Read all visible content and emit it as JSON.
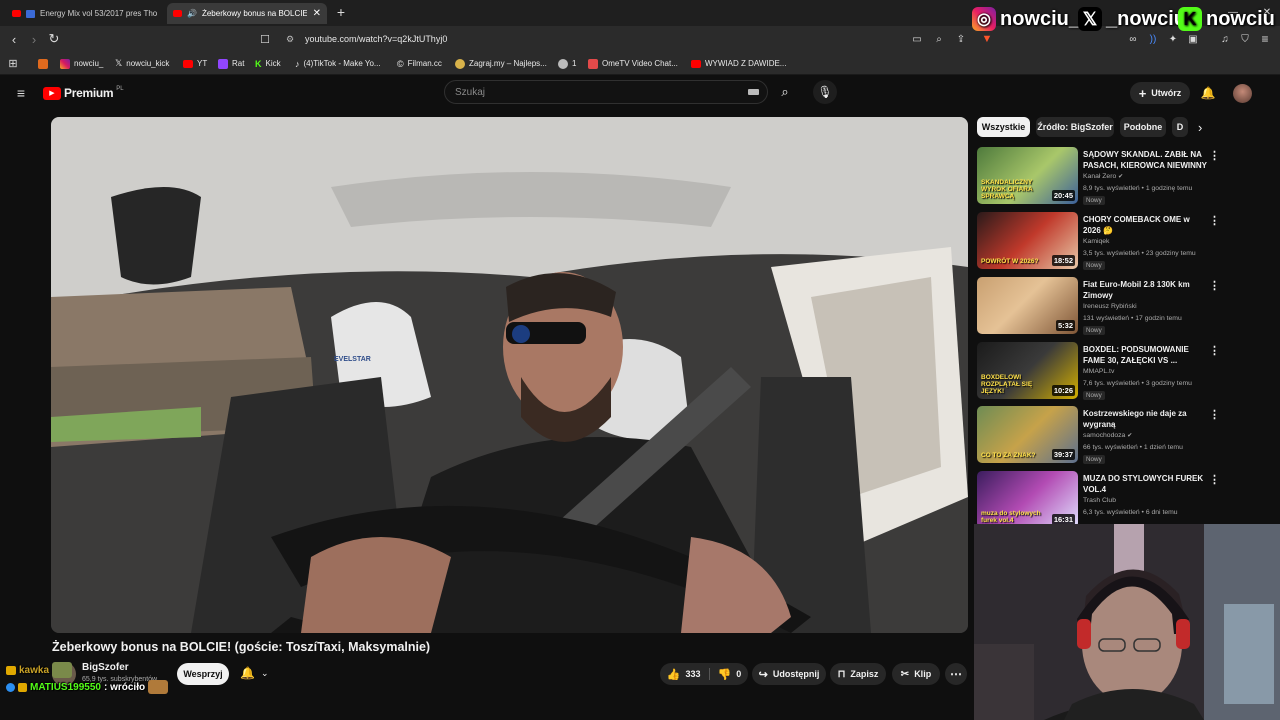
{
  "tabs": [
    {
      "title": "Energy Mix vol 53/2017 pres Tho"
    },
    {
      "title": "Żeberkowy bonus na BOLCIE!"
    }
  ],
  "address": {
    "url": "youtube.com/watch?v=q2kJtUThyj0"
  },
  "bookmarks": [
    "nowciu_",
    "nowciu_kick",
    "YT",
    "Rat",
    "Kick",
    "(4)TikTok - Make Yo...",
    "Filman.cc",
    "Zagraj.my – Najleps...",
    "1",
    "OmeTV Video Chat...",
    "WYWIAD Z DAWIDE..."
  ],
  "socials": {
    "instagram": "nowciu_",
    "x": "_nowciu",
    "kick": "nowciu"
  },
  "youtube": {
    "logo": "Premium",
    "logo_badge": "PL",
    "search_placeholder": "Szukaj",
    "create_label": "Utwórz"
  },
  "video": {
    "title": "Żeberkowy bonus na BOLCIE! (goście: ToszíTaxi, Maksymalnie)",
    "seat_brand": "EVELSTAR"
  },
  "channel": {
    "name": "BigSzofer",
    "subscribers": "65,9 tys. subskrybentów",
    "support_label": "Wesprzyj"
  },
  "actions": {
    "likes": "333",
    "dislikes": "0",
    "share": "Udostępnij",
    "save": "Zapisz",
    "clip": "Klip"
  },
  "chips": [
    "Wszystkie",
    "Źródło: BigSzofer",
    "Podobne",
    "D"
  ],
  "recommendations": [
    {
      "title": "SĄDOWY SKANDAL. ZABIŁ NA PASACH, KIEROWCA NIEWINNY",
      "channel": "Kanał Zero",
      "verified": true,
      "meta": "8,9 tys. wyświetleń • 1 godzinę temu",
      "badge": "Nowy",
      "duration": "20:45",
      "thumb_text": "SKANDALICZNY WYROK OFIARA SPRAWCĄ"
    },
    {
      "title": "CHORY COMEBACK OME w 2026 🤔",
      "channel": "Kamiqek",
      "verified": false,
      "meta": "3,5 tys. wyświetleń • 23 godziny temu",
      "badge": "Nowy",
      "duration": "18:52",
      "thumb_text": "POWRÓT W 2026?"
    },
    {
      "title": "Fiat Euro-Mobil 2.8 130K km Zimowy",
      "channel": "Ireneusz Rybiński",
      "verified": false,
      "meta": "131 wyświetleń • 17 godzin temu",
      "badge": "Nowy",
      "duration": "5:32",
      "thumb_text": ""
    },
    {
      "title": "BOXDEL: PODSUMOWANIE FAME 30, ZAŁĘCKI VS ...",
      "channel": "MMAPL.tv",
      "verified": false,
      "meta": "7,6 tys. wyświetleń • 3 godziny temu",
      "badge": "Nowy",
      "duration": "10:26",
      "thumb_text": "BOXDELOWI ROZPLĄTAŁ SIĘ JĘZYK!"
    },
    {
      "title": "Kostrzewskiego nie daje za wygraną",
      "channel": "samochodoza",
      "verified": true,
      "meta": "66 tys. wyświetleń • 1 dzień temu",
      "badge": "Nowy",
      "duration": "39:37",
      "thumb_text": "CO TO ZA ZNAK?"
    },
    {
      "title": "MUZA DO STYLOWYCH FUREK VOL.4",
      "channel": "Trash Club",
      "verified": false,
      "meta": "6,3 tys. wyświetleń • 6 dni temu",
      "badge": "",
      "duration": "16:31",
      "thumb_text": "muza do stylowych furek vol.4"
    }
  ],
  "chat": [
    {
      "user": "kawka",
      "message": ""
    },
    {
      "user": "MATIUS199550",
      "message": ": wróciło"
    }
  ],
  "colors": {
    "yt_red": "#ff0000",
    "kick_green": "#53fc18",
    "bg": "#0f0f0f"
  }
}
